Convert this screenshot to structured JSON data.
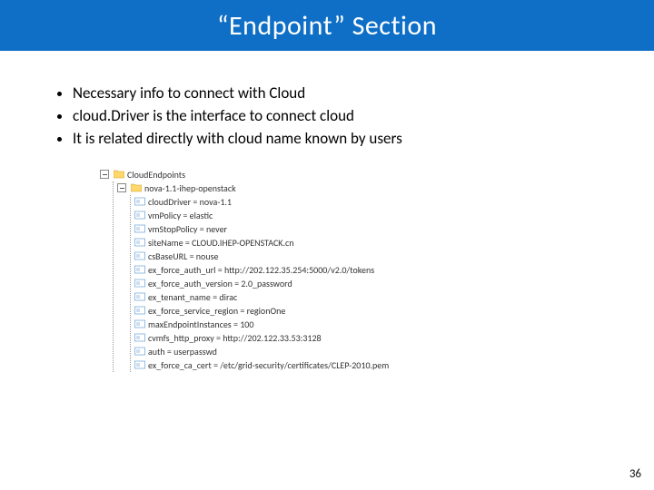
{
  "title": "“Endpoint” Section",
  "bullets": [
    "Necessary info to connect with Cloud",
    "cloud.Driver is the interface to connect cloud",
    "It is related directly with cloud name known by users"
  ],
  "tree": {
    "root": {
      "label": "CloudEndpoints"
    },
    "child": {
      "label": "nova-1.1-ihep-openstack"
    },
    "attrs": [
      "cloudDriver = nova-1.1",
      "vmPolicy = elastic",
      "vmStopPolicy = never",
      "siteName = CLOUD.IHEP-OPENSTACK.cn",
      "csBaseURL = nouse",
      "ex_force_auth_url = http://202.122.35.254:5000/v2.0/tokens",
      "ex_force_auth_version = 2.0_password",
      "ex_tenant_name = dirac",
      "ex_force_service_region = regionOne",
      "maxEndpointInstances = 100",
      "cvmfs_http_proxy = http://202.122.33.53:3128",
      "auth = userpasswd",
      "ex_force_ca_cert = /etc/grid-security/certificates/CLEP-2010.pem"
    ]
  },
  "page_number": "36"
}
